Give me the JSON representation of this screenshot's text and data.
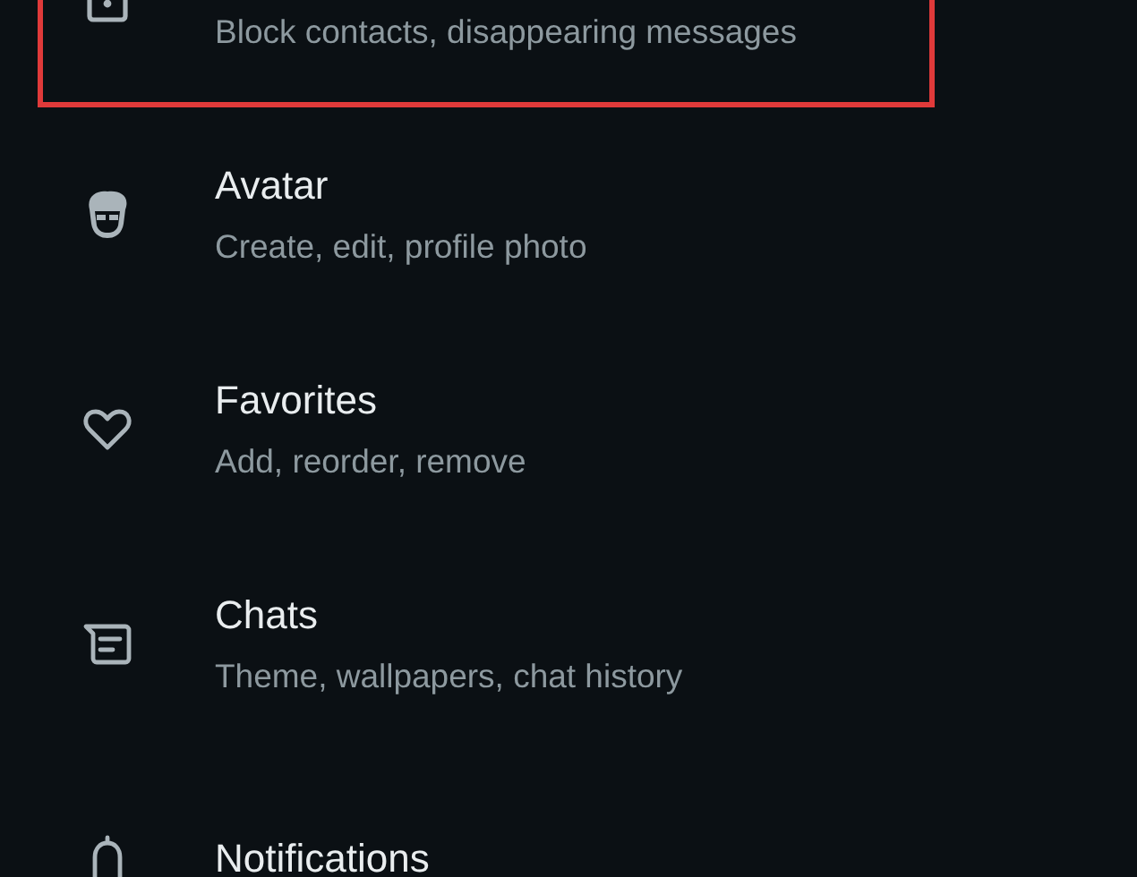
{
  "settings_items": [
    {
      "subtitle": "Block contacts, disappearing messages",
      "highlighted": true
    },
    {
      "title": "Avatar",
      "subtitle": "Create, edit, profile photo",
      "highlighted": false
    },
    {
      "title": "Favorites",
      "subtitle": "Add, reorder, remove",
      "highlighted": false
    },
    {
      "title": "Chats",
      "subtitle": "Theme, wallpapers, chat history",
      "highlighted": false
    },
    {
      "title": "Notifications",
      "highlighted": false
    }
  ]
}
